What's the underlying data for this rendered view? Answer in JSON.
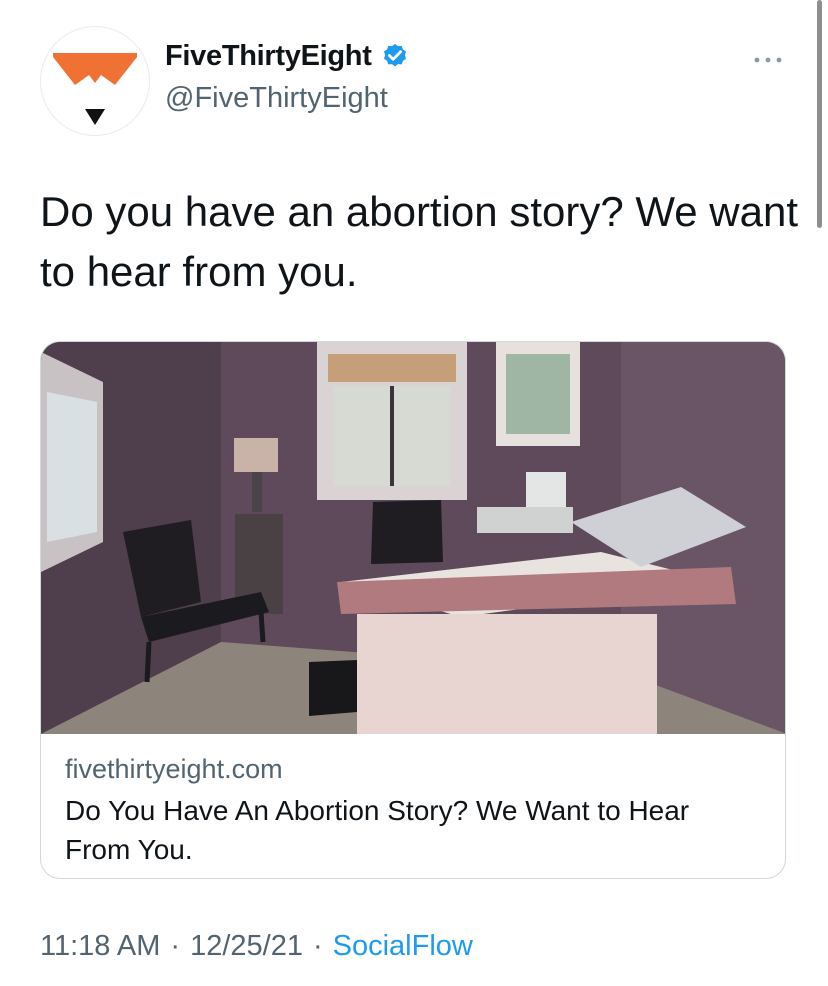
{
  "author": {
    "display_name": "FiveThirtyEight",
    "handle": "@FiveThirtyEight",
    "verified": true,
    "avatar_icon": "fivethirtyeight-fox-logo",
    "brand_color": "#ef7234"
  },
  "tweet": {
    "text": "Do you have an abortion story? We want to hear from you."
  },
  "card": {
    "image_icon": "exam-room-photo",
    "domain": "fivethirtyeight.com",
    "title": "Do You Have An Abortion Story? We Want to Hear From You."
  },
  "meta": {
    "time": "11:18 AM",
    "separator": "·",
    "date": "12/25/21",
    "source": "SocialFlow"
  },
  "colors": {
    "text": "#0f1419",
    "secondary": "#536471",
    "link": "#1d9bf0",
    "border": "#cfd9de"
  }
}
